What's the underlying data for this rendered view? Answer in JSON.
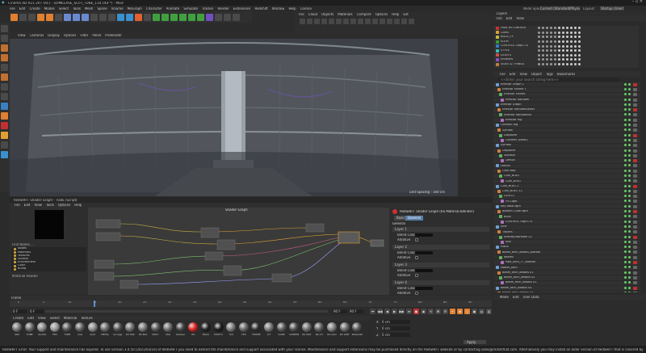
{
  "window": {
    "title": "Cinema 4D R21.207 (RC) - [DIMELASE_SCIFI_TUBE_110.c4d *] - Main"
  },
  "menubar": [
    "File",
    "Edit",
    "Create",
    "Modes",
    "Select",
    "Tools",
    "Mesh",
    "Spline",
    "Volume",
    "MoGraph",
    "Character",
    "Animate",
    "Simulate",
    "Tracker",
    "Render",
    "Extensions",
    "Redshift",
    "Window",
    "Help",
    "Corona"
  ],
  "topright": {
    "node_space_label": "Node Space:",
    "node_space": "Current (Standard/Physical)",
    "layout_label": "Layout:",
    "layout": "Startup (User)"
  },
  "viewport": {
    "menus": [
      "View",
      "Cameras",
      "Display",
      "Options",
      "Filter",
      "Panel",
      "ProRender"
    ],
    "name": "Perspective",
    "grid": "Grid Spacing : 100 cm"
  },
  "picture_viewer": {
    "menus": [
      "File",
      "Cloud",
      "Objects",
      "Materials",
      "Compare",
      "Options",
      "Help",
      "Ext"
    ]
  },
  "layers": {
    "title": "Layers",
    "menus": [
      "File",
      "Edit",
      "View"
    ],
    "items": [
      "HIDE IN CUBOIDS",
      "CAMS",
      "BACK_FP",
      "ELEM",
      "CONTROL OBJECTS",
      "STYLE",
      "LIGHTS",
      "Emitters",
      "SIDES & THINGS"
    ],
    "colors": [
      "#d03030",
      "#e0a030",
      "#c0c040",
      "#30a030",
      "#3080d0",
      "#30c0c0",
      "#d05050",
      "#9050c0",
      "#c08040"
    ]
  },
  "objects": {
    "menus": [
      "File",
      "Edit",
      "View",
      "Object",
      "Tags",
      "Bookmarks"
    ],
    "search": "<<Enter your search string here>>",
    "items": [
      "Effector Graph 1",
      "Effector Fieldnt 1",
      "Effector Fieldnt",
      "Effector Random",
      "Effector Graph",
      "Effector RandomSelect",
      "Effector RandomAlt",
      "Effector Rig",
      "Connect Rig",
      "Symbol",
      "Displacer",
      "Connect (small)",
      "Symbol",
      "Displacer",
      "Vibrator",
      "Lemon",
      "Lemon",
      "Cam Map",
      "CAM_BOX1",
      "CAM_BOX1",
      "CAM_BOX1 2",
      "CAM_BOX1 12",
      "LIGHTS",
      "Fill Light",
      "Key Base light",
      "Bottom Cube light",
      "BASE",
      "CONTROL OBJECTS",
      "Sine",
      "Tracers",
      "Effector/Random 02",
      "Null",
      "Plane",
      "Beam_tech_details_bottom",
      "Beams",
      "Pipe_tech_TT_bottom",
      "cables_tech",
      "Beam_tech_details 01",
      "Beam_tech_details 02",
      "Beam_tech_details 03",
      "Beam_tech_details 04",
      "Beam_tech_details 05",
      "Beam_tech_details 06"
    ],
    "footer": [
      "Mode",
      "Edit",
      "User Data"
    ]
  },
  "shader_graph": {
    "menus": [
      "File",
      "Edit",
      "View",
      "Tools",
      "Options",
      "Help"
    ],
    "title": "Shader Graph",
    "window_title": "RedSHIFT Shader Graph - TUBE (Script)",
    "find_label": "Find Nodes...",
    "categories": [
      "Nodes",
      "Materials",
      "Textures",
      "Utilities",
      "Environment",
      "Color",
      "Bump"
    ],
    "material_header": "Material Header",
    "right_title": "RedSHIFT Shader Graph (RS Material Blender)",
    "right_tabs": [
      "Basic",
      "General"
    ],
    "general": "General",
    "layers": [
      "Layer 1",
      "Layer 2",
      "Layer 3",
      "Layer 4"
    ],
    "blend_color": "Blend Color",
    "additive": "Additive",
    "nodes": [
      "RS Material",
      "Texture",
      "Triplanar",
      "Blender",
      "Color Layer",
      "Bump Map",
      "Output"
    ]
  },
  "timeline": {
    "label": "Frame",
    "ticks": [
      "0",
      "5",
      "10",
      "15",
      "20",
      "25",
      "30",
      "35",
      "40",
      "45",
      "50",
      "55",
      "60",
      "65",
      "70",
      "75",
      "80",
      "85",
      "90"
    ],
    "start": "0 F",
    "end": "90 F",
    "current": "0 F",
    "fps": "90 F"
  },
  "material_mgr": {
    "menus": [
      "Create",
      "Edit",
      "View",
      "Select",
      "Material",
      "Texture"
    ],
    "materials": [
      "Mat",
      "TUBE",
      "GLASS",
      "TEO",
      "TUBE",
      "mat",
      "Gold",
      "METAL",
      "Grunge",
      "RS Mat",
      "RS Mat",
      "MAT1",
      "Mat",
      "Rubber",
      "RS",
      "Black",
      "MATIT1",
      "TCX",
      "TEX",
      "FRAME",
      "LIT",
      "CORE",
      "SCREEN",
      "RS MAT",
      "RS LIT",
      "RS GLO",
      "RS LINE",
      "RSGLOW"
    ],
    "colors": [
      "#777",
      "#666",
      "#888",
      "#999",
      "#555",
      "#606060",
      "#8a8a8a",
      "#6a6a6a",
      "#505050",
      "#707070",
      "#757575",
      "#555",
      "#6d6d6d",
      "#444",
      "#e02020",
      "#222",
      "#1e1e1e",
      "#7a7a7a",
      "#666",
      "#303030",
      "#777",
      "#5a5a5a",
      "#4e4e4e",
      "#6e6e6e",
      "#606060",
      "#808080",
      "#6a6a6a",
      "#555"
    ]
  },
  "coords": {
    "labels": [
      "X",
      "Y",
      "Z"
    ],
    "values": [
      "0 cm",
      "0 cm",
      "0 cm"
    ],
    "apply": "Apply"
  },
  "status": "RedSHIFT Error: Your support and maintenance has expired. To use version 3.0.50 (2021/03/10) of RedSHIFT you need to extend the maintenance and support associated with your license. Maintenance and support extensions may be purchased directly on the RedSHIFT website or by contacting sales@redshift3d.com. Alternatively you may install an older version of RedSHIFT that is covered by your current license."
}
